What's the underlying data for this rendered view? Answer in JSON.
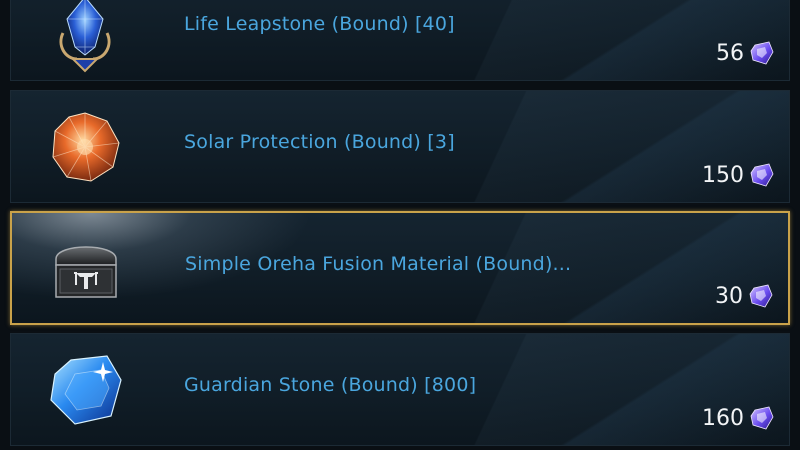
{
  "items": [
    {
      "name": "Life Leapstone (Bound) [40]",
      "price": "56",
      "icon": "life-leapstone-icon",
      "selected": false
    },
    {
      "name": "Solar Protection (Bound) [3]",
      "price": "150",
      "icon": "solar-protection-icon",
      "selected": false
    },
    {
      "name": "Simple Oreha Fusion Material (Bound)...",
      "price": "30",
      "icon": "oreha-chest-icon",
      "selected": true
    },
    {
      "name": "Guardian Stone (Bound) [800]",
      "price": "160",
      "icon": "guardian-stone-icon",
      "selected": false
    }
  ],
  "currency_icon": "crystal-currency-icon",
  "colors": {
    "item_name": "#4aa6de",
    "price": "#f2f4f6",
    "selected_border": "#c9a24a",
    "row_bg": "#122029"
  }
}
